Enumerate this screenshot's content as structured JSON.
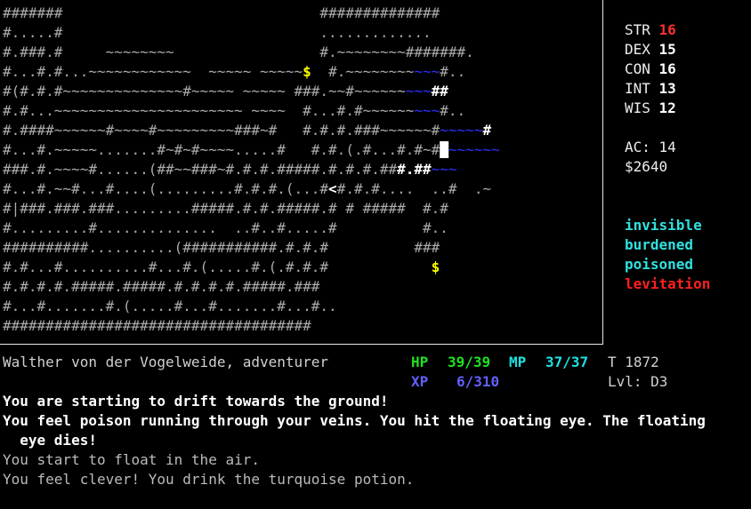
{
  "map": {
    "rows": [
      [
        {
          "t": "#######                              ##############",
          "c": ""
        }
      ],
      [
        {
          "t": "#.....#                              .............",
          "c": ""
        }
      ],
      [
        {
          "t": "#.###.#     ~~~~~~~~                 #.~~~~~~~~#######.",
          "c": ""
        }
      ],
      [
        {
          "t": "#...#.#...~~~~~~~~~~~~  ~~~~~ ~~~~~",
          "c": ""
        },
        {
          "t": "$",
          "c": "gold"
        },
        {
          "t": "  #.~~~~~~~~",
          "c": ""
        },
        {
          "t": "~~~",
          "c": "blue"
        },
        {
          "t": "#..",
          "c": ""
        }
      ],
      [
        {
          "t": "#(#.#.#~~~~~~~~~~~~~~#~~~~~ ~~~~~ ###.~~#~~~~~~",
          "c": ""
        },
        {
          "t": "~~~",
          "c": "blue"
        },
        {
          "t": "##",
          "c": "hi"
        }
      ],
      [
        {
          "t": "#.#...~~~~~~~~~~~~~~~~~~~~~~ ~~~~  #...#.#~~~~~~",
          "c": ""
        },
        {
          "t": "~~~",
          "c": "blue"
        },
        {
          "t": "#..",
          "c": ""
        }
      ],
      [
        {
          "t": "#.####~~~~~~#~~~~#~~~~~~~~~###~#   #.#.#.###~~~~~~#",
          "c": ""
        },
        {
          "t": "~~~~~",
          "c": "blue"
        },
        {
          "t": "#",
          "c": "hi"
        }
      ],
      [
        {
          "t": "#...#.~~~~~.......#~#~#~~~~.....#   #.#.(.#...#.#~#",
          "c": ""
        },
        {
          "t": "█",
          "c": "hi"
        },
        {
          "t": "~~~~~~",
          "c": "blue"
        }
      ],
      [
        {
          "t": "###.#.~~~~#......(##~~###~#.#.#.#####.#.#.#.##",
          "c": ""
        },
        {
          "t": "#.##",
          "c": "hi"
        },
        {
          "t": "~~~",
          "c": "blue"
        }
      ],
      [
        {
          "t": "#...#.~~#...#....(.........#.#.#.(...#",
          "c": ""
        },
        {
          "t": "<",
          "c": "hi"
        },
        {
          "t": "#.#.#....  ..#  .~",
          "c": ""
        }
      ],
      [
        {
          "t": "#|###.###.###.........#####.#.#.#####.# # #####  #.#",
          "c": ""
        }
      ],
      [
        {
          "t": "#.........#..............  ..#..#.....#          #..",
          "c": ""
        }
      ],
      [
        {
          "t": "##########..........(###########.#.#.#          ###",
          "c": ""
        }
      ],
      [
        {
          "t": "#.#...#..........#...#.(.....#.(.#.#.#            ",
          "c": ""
        },
        {
          "t": "$",
          "c": "gold"
        }
      ],
      [
        {
          "t": "#.#.#.#.#####.#####.#.#.#.#.#####.###",
          "c": ""
        }
      ],
      [
        {
          "t": "#...#.......#.(.....#...#.......#...#..",
          "c": ""
        }
      ],
      [
        {
          "t": "####################################",
          "c": ""
        }
      ]
    ]
  },
  "stats": {
    "str": {
      "label": "STR ",
      "value": "16"
    },
    "dex": {
      "label": "DEX ",
      "value": "15"
    },
    "con": {
      "label": "CON ",
      "value": "16"
    },
    "int": {
      "label": "INT ",
      "value": "13"
    },
    "wis": {
      "label": "WIS ",
      "value": "12"
    },
    "ac": {
      "label": "AC: ",
      "value": "14"
    },
    "gold": "$2640"
  },
  "status_effects": [
    "invisible",
    "burdened",
    "poisoned",
    "levitation"
  ],
  "status_colors": {
    "invisible": "cyan",
    "burdened": "cyan",
    "poisoned": "cyan",
    "levitation": "red"
  },
  "character": {
    "name": "Walther von der Vogelweide, adventurer"
  },
  "vitals": {
    "hp_label": "HP",
    "hp": "39/39",
    "mp_label": "MP",
    "mp": "37/37",
    "xp_label": "XP",
    "xp": "6/310",
    "turn": "T 1872",
    "level": "Lvl: D3"
  },
  "messages": [
    {
      "text": "You are starting to drift towards the ground!",
      "kind": "new"
    },
    {
      "text": "You feel poison running through your veins. You hit the floating eye. The floating\n  eye dies!",
      "kind": "new"
    },
    {
      "text": "You start to float in the air.",
      "kind": "old"
    },
    {
      "text": "You feel clever! You drink the turquoise potion.",
      "kind": "old"
    }
  ]
}
